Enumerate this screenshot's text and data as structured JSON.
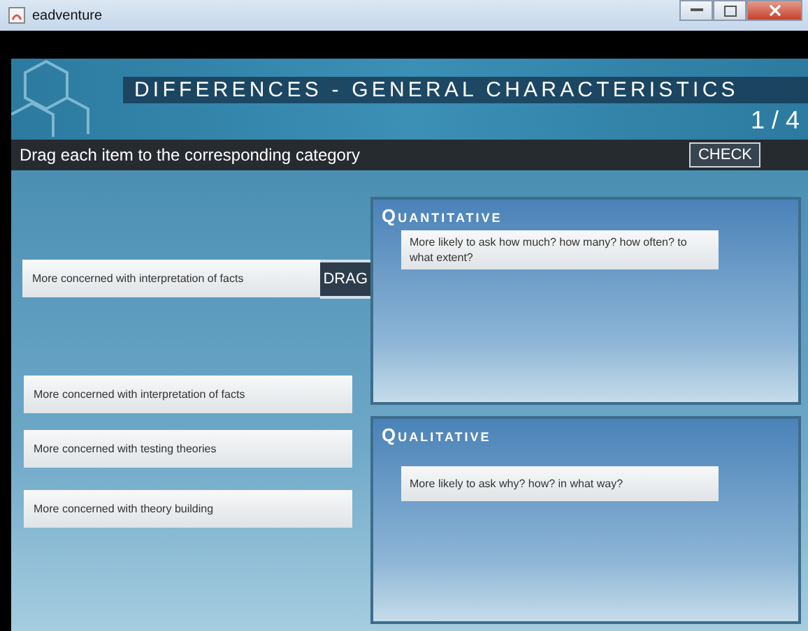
{
  "window": {
    "title": "eadventure"
  },
  "header": {
    "title": "DIFFERENCES - GENERAL CHARACTERISTICS",
    "progress": "1 / 4"
  },
  "instruction": "Drag each item to the corresponding category",
  "check_button": "CHECK",
  "items": [
    {
      "text": "More concerned with interpretation of facts",
      "dragging": true,
      "handle": "DRAG"
    },
    {
      "text": "More concerned with interpretation of facts",
      "dragging": false
    },
    {
      "text": "More concerned with testing theories",
      "dragging": false
    },
    {
      "text": "More concerned with theory building",
      "dragging": false
    }
  ],
  "categories": [
    {
      "title": "Quantitative",
      "items": [
        "More likely to ask how much? how many? how often? to what extent?"
      ]
    },
    {
      "title": "Qualitative",
      "items": [
        "More likely to ask why? how? in what way?"
      ]
    }
  ]
}
